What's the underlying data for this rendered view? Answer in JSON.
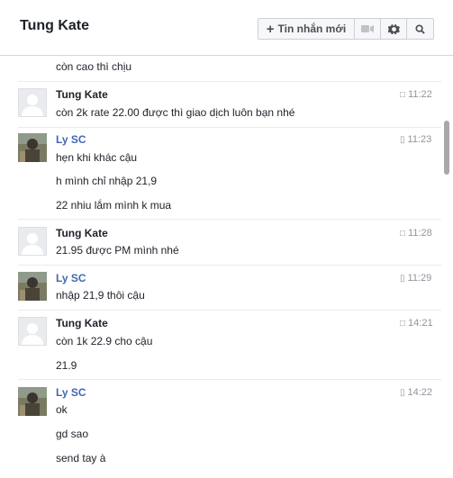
{
  "header": {
    "title": "Tung Kate",
    "new_message_label": "Tin nhắn mới"
  },
  "messages": [
    {
      "text": "còn cao thì chịu"
    },
    {
      "sender": "Tung Kate",
      "time": "11:22",
      "lines": [
        "còn 2k rate 22.00 được thì giao dịch luôn bạn nhé"
      ]
    },
    {
      "sender": "Ly SC",
      "time": "11:23",
      "lines": [
        "hẹn khi khác cậu",
        "h mình chỉ nhập 21,9",
        "22 nhiu lắm mình k mua"
      ]
    },
    {
      "sender": "Tung Kate",
      "time": "11:28",
      "lines": [
        "21.95 được PM mình nhé"
      ]
    },
    {
      "sender": "Ly SC",
      "time": "11:29",
      "lines": [
        "nhập 21,9 thôi cậu"
      ]
    },
    {
      "sender": "Tung Kate",
      "time": "14:21",
      "lines": [
        "còn 1k 22.9 cho cậu",
        "21.9"
      ]
    },
    {
      "sender": "Ly SC",
      "time": "14:22",
      "lines": [
        "ok",
        "gd sao",
        "send tay à"
      ]
    }
  ]
}
